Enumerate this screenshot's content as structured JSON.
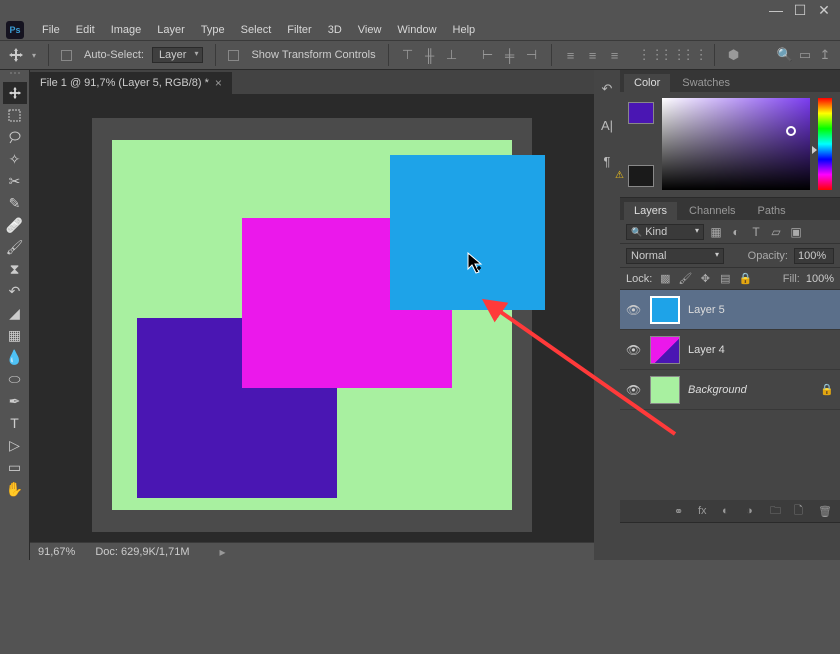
{
  "titlebar": {
    "minimize": "—",
    "maximize": "☐",
    "close": "✕"
  },
  "menubar": {
    "ps": "Ps",
    "items": [
      "File",
      "Edit",
      "Image",
      "Layer",
      "Type",
      "Select",
      "Filter",
      "3D",
      "View",
      "Window",
      "Help"
    ]
  },
  "optionsbar": {
    "autoSelect": "Auto-Select:",
    "layerDropdown": "Layer",
    "showTransform": "Show Transform Controls"
  },
  "document": {
    "tabTitle": "File 1 @ 91,7% (Layer 5, RGB/8) *"
  },
  "statusbar": {
    "zoom": "91,67%",
    "docsize": "Doc: 629,9K/1,71M"
  },
  "panels": {
    "color": {
      "tab1": "Color",
      "tab2": "Swatches"
    },
    "layers": {
      "tabs": [
        "Layers",
        "Channels",
        "Paths"
      ],
      "kind": "Kind",
      "blend": "Normal",
      "opacityLabel": "Opacity:",
      "opacityVal": "100%",
      "lockLabel": "Lock:",
      "fillLabel": "Fill:",
      "fillVal": "100%",
      "rows": [
        {
          "name": "Layer 5",
          "color": "#1ea3e8",
          "selected": true
        },
        {
          "name": "Layer 4",
          "color": "#eb18eb"
        },
        {
          "name": "Background",
          "color": "#a8f0a0",
          "italic": true,
          "locked": true
        }
      ]
    }
  }
}
